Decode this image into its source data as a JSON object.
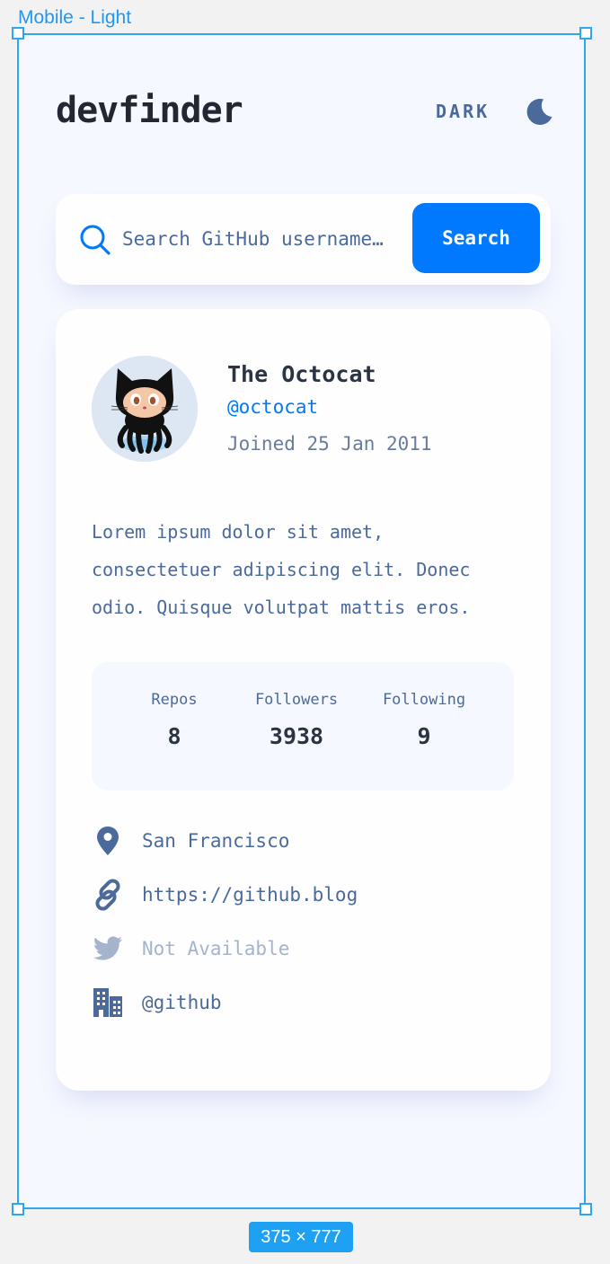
{
  "canvas": {
    "frame_label": "Mobile - Light",
    "size_badge": "375 × 777"
  },
  "header": {
    "logo": "devfinder",
    "theme_label": "DARK",
    "theme_icon": "moon-icon"
  },
  "search": {
    "placeholder": "Search GitHub username…",
    "button_label": "Search",
    "icon": "search-icon"
  },
  "profile": {
    "name": "The Octocat",
    "login": "@octocat",
    "joined": "Joined 25 Jan 2011",
    "bio": "Lorem ipsum dolor sit amet, consectetuer adipiscing elit. Donec odio. Quisque volutpat mattis eros.",
    "stats": [
      {
        "label": "Repos",
        "value": "8"
      },
      {
        "label": "Followers",
        "value": "3938"
      },
      {
        "label": "Following",
        "value": "9"
      }
    ],
    "links": {
      "location": "San Francisco",
      "blog": "https://github.blog",
      "twitter": "Not Available",
      "company": "@github"
    }
  },
  "colors": {
    "accent": "#0079ff",
    "background": "#f6f8ff",
    "card": "#fefefe",
    "text_primary": "#2b3442",
    "text_secondary": "#4b6a9b",
    "disabled": "#a5b4cc",
    "selection": "#2ea6f0"
  }
}
